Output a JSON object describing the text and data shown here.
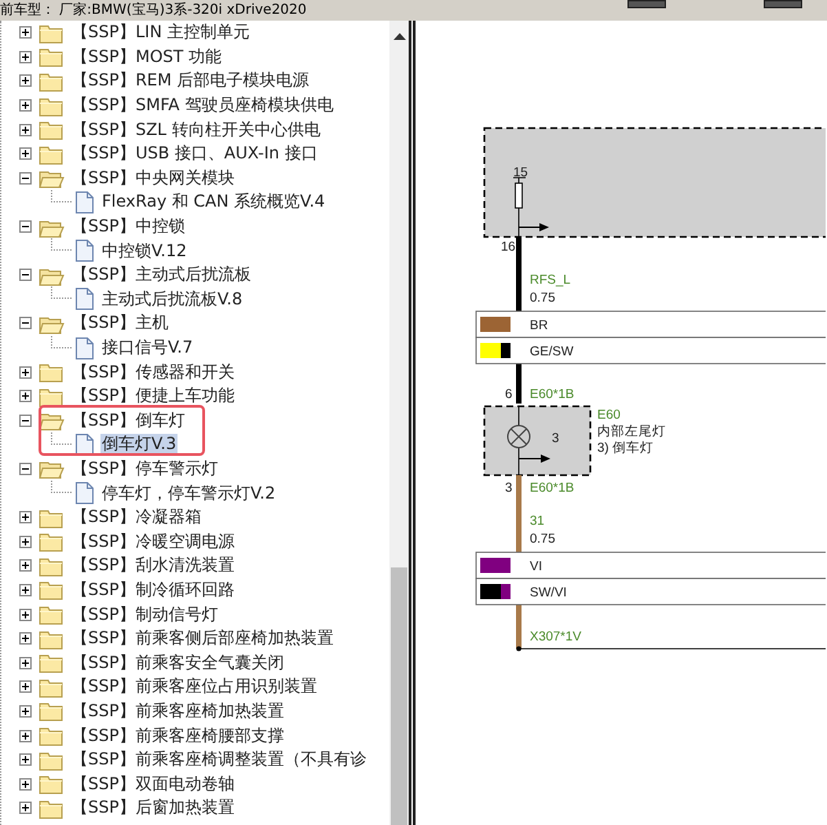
{
  "top_bar": {
    "vehicle": "前车型： 厂家:BMW(宝马)3系-320i xDrive2020"
  },
  "tree": [
    {
      "kind": "folder",
      "label": "【SSP】LIN 主控制单元",
      "expanded": false,
      "selected": false,
      "highlighted": false
    },
    {
      "kind": "folder",
      "label": "【SSP】MOST 功能",
      "expanded": false,
      "selected": false,
      "highlighted": false
    },
    {
      "kind": "folder",
      "label": "【SSP】REM 后部电子模块电源",
      "expanded": false,
      "selected": false,
      "highlighted": false
    },
    {
      "kind": "folder",
      "label": "【SSP】SMFA 驾驶员座椅模块供电",
      "expanded": false,
      "selected": false,
      "highlighted": false
    },
    {
      "kind": "folder",
      "label": "【SSP】SZL 转向柱开关中心供电",
      "expanded": false,
      "selected": false,
      "highlighted": false
    },
    {
      "kind": "folder",
      "label": "【SSP】USB 接口、AUX-In 接口",
      "expanded": false,
      "selected": false,
      "highlighted": false
    },
    {
      "kind": "folder",
      "label": "【SSP】中央网关模块",
      "expanded": true,
      "selected": false,
      "highlighted": false,
      "children": [
        {
          "kind": "document",
          "label": "FlexRay 和 CAN 系统概览V.4",
          "selected": false
        }
      ]
    },
    {
      "kind": "folder",
      "label": "【SSP】中控锁",
      "expanded": true,
      "selected": false,
      "highlighted": false,
      "children": [
        {
          "kind": "document",
          "label": "中控锁V.12",
          "selected": false
        }
      ]
    },
    {
      "kind": "folder",
      "label": "【SSP】主动式后扰流板",
      "expanded": true,
      "selected": false,
      "highlighted": false,
      "children": [
        {
          "kind": "document",
          "label": "主动式后扰流板V.8",
          "selected": false
        }
      ]
    },
    {
      "kind": "folder",
      "label": "【SSP】主机",
      "expanded": true,
      "selected": false,
      "highlighted": false,
      "children": [
        {
          "kind": "document",
          "label": "接口信号V.7",
          "selected": false
        }
      ]
    },
    {
      "kind": "folder",
      "label": "【SSP】传感器和开关",
      "expanded": false,
      "selected": false,
      "highlighted": false
    },
    {
      "kind": "folder",
      "label": "【SSP】便捷上车功能",
      "expanded": false,
      "selected": false,
      "highlighted": false
    },
    {
      "kind": "folder",
      "label": "【SSP】倒车灯",
      "expanded": true,
      "selected": false,
      "highlighted": true,
      "children": [
        {
          "kind": "document",
          "label": "倒车灯V.3",
          "selected": true
        }
      ]
    },
    {
      "kind": "folder",
      "label": "【SSP】停车警示灯",
      "expanded": true,
      "selected": false,
      "highlighted": false,
      "children": [
        {
          "kind": "document",
          "label": "停车灯，停车警示灯V.2",
          "selected": false
        }
      ]
    },
    {
      "kind": "folder",
      "label": "【SSP】冷凝器箱",
      "expanded": false,
      "selected": false,
      "highlighted": false
    },
    {
      "kind": "folder",
      "label": "【SSP】冷暖空调电源",
      "expanded": false,
      "selected": false,
      "highlighted": false
    },
    {
      "kind": "folder",
      "label": "【SSP】刮水清洗装置",
      "expanded": false,
      "selected": false,
      "highlighted": false
    },
    {
      "kind": "folder",
      "label": "【SSP】制冷循环回路",
      "expanded": false,
      "selected": false,
      "highlighted": false
    },
    {
      "kind": "folder",
      "label": "【SSP】制动信号灯",
      "expanded": false,
      "selected": false,
      "highlighted": false
    },
    {
      "kind": "folder",
      "label": "【SSP】前乘客侧后部座椅加热装置",
      "expanded": false,
      "selected": false,
      "highlighted": false
    },
    {
      "kind": "folder",
      "label": "【SSP】前乘客安全气囊关闭",
      "expanded": false,
      "selected": false,
      "highlighted": false
    },
    {
      "kind": "folder",
      "label": "【SSP】前乘客座位占用识别装置",
      "expanded": false,
      "selected": false,
      "highlighted": false
    },
    {
      "kind": "folder",
      "label": "【SSP】前乘客座椅加热装置",
      "expanded": false,
      "selected": false,
      "highlighted": false
    },
    {
      "kind": "folder",
      "label": "【SSP】前乘客座椅腰部支撑",
      "expanded": false,
      "selected": false,
      "highlighted": false
    },
    {
      "kind": "folder",
      "label": "【SSP】前乘客座椅调整装置（不具有诊",
      "expanded": false,
      "selected": false,
      "highlighted": false
    },
    {
      "kind": "folder",
      "label": "【SSP】双面电动卷轴",
      "expanded": false,
      "selected": false,
      "highlighted": false
    },
    {
      "kind": "folder",
      "label": "【SSP】后窗加热装置",
      "expanded": false,
      "selected": false,
      "highlighted": false
    }
  ],
  "diagram": {
    "module": {
      "pin_label": "15",
      "pin": "16"
    },
    "wires": [
      {
        "color": "#000000",
        "signal": "RFS_L",
        "gauge": "0.75",
        "colors": [
          {
            "code": "BR",
            "swatch": [
              {
                "color": "#9c6434"
              }
            ]
          },
          {
            "code": "GE/SW",
            "swatch": [
              {
                "color": "#ffff00"
              },
              {
                "color": "#000000"
              }
            ]
          }
        ]
      },
      {
        "color": "#a87a4a",
        "signal": "31",
        "gauge": "0.75",
        "colors": [
          {
            "code": "VI",
            "swatch": [
              {
                "color": "#800080"
              }
            ]
          },
          {
            "code": "SW/VI",
            "swatch": [
              {
                "color": "#000000"
              },
              {
                "color": "#800080"
              }
            ]
          }
        ]
      }
    ],
    "lamp": {
      "pin_in": "6",
      "connector_in": "E60*1B",
      "pin_out": "3",
      "connector_out": "E60*1B",
      "terminal": "3",
      "code": "E60",
      "name": "内部左尾灯",
      "note": "3)  倒车灯"
    },
    "ground_connector": "X307*1V"
  }
}
